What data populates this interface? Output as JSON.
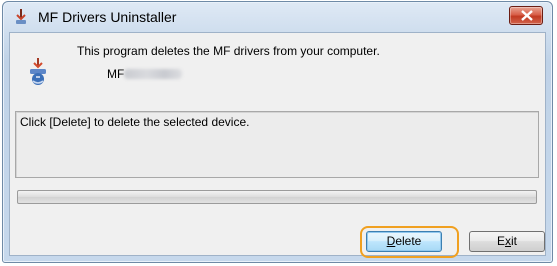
{
  "window": {
    "title": "MF Drivers Uninstaller"
  },
  "info": {
    "text": "This program deletes the MF drivers from your computer.",
    "device_prefix": "MF"
  },
  "message": {
    "text": "Click [Delete] to delete the selected device."
  },
  "progress": {
    "value": 0
  },
  "buttons": {
    "delete_first": "D",
    "delete_rest": "elete",
    "exit_first": "E",
    "exit_underline": "x",
    "exit_rest": "it"
  },
  "colors": {
    "highlight": "#f0a020",
    "close_button": "#c23a22",
    "client_background": "#f0f0f0"
  },
  "icons": [
    "app-icon",
    "close-icon",
    "uninstall-icon"
  ]
}
